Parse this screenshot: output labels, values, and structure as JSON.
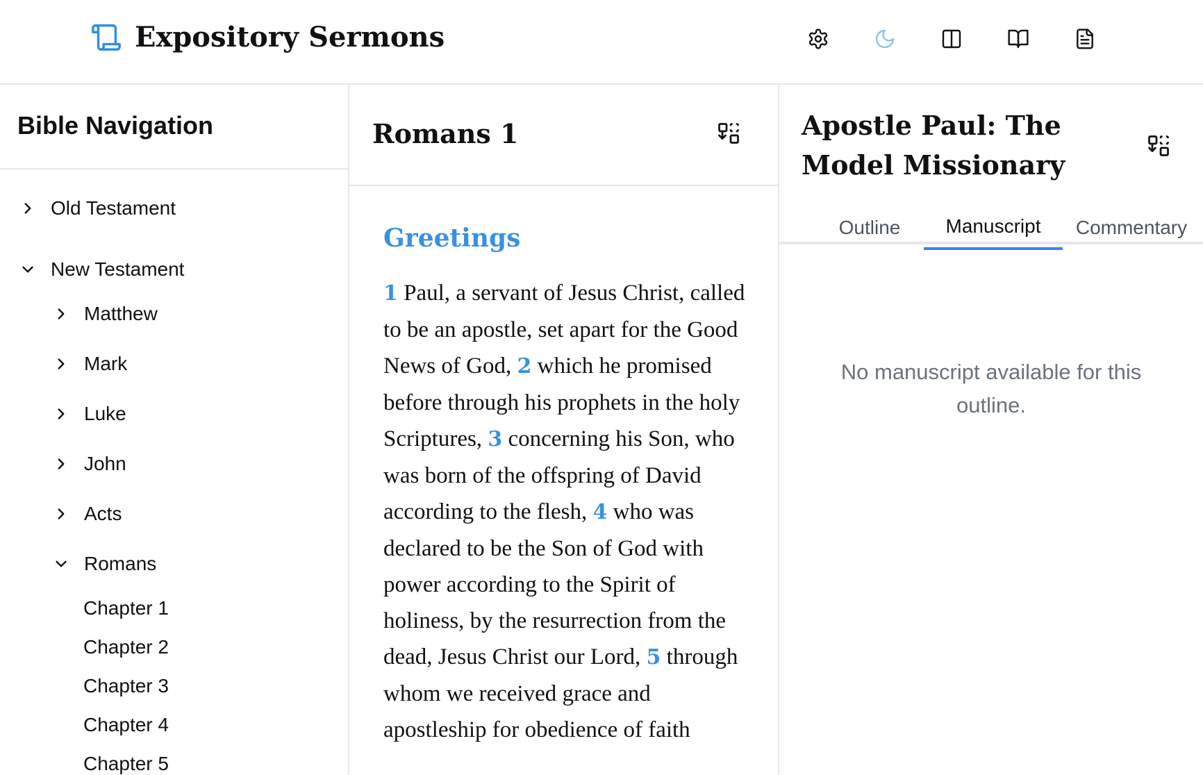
{
  "header": {
    "title": "Expository Sermons",
    "logo_icon": "scroll-icon",
    "accent": "#3b91e0",
    "toolbar": [
      {
        "name": "settings-button",
        "icon": "gear-icon"
      },
      {
        "name": "dark-mode-button",
        "icon": "moon-icon"
      },
      {
        "name": "split-view-button",
        "icon": "columns-icon"
      },
      {
        "name": "bible-button",
        "icon": "book-open-icon"
      },
      {
        "name": "notes-button",
        "icon": "document-icon"
      }
    ]
  },
  "nav": {
    "title": "Bible Navigation",
    "old_testament": "Old Testament",
    "new_testament": "New Testament",
    "books": [
      "Matthew",
      "Mark",
      "Luke",
      "John",
      "Acts",
      "Romans"
    ],
    "open_book": "Romans",
    "chapters": [
      "Chapter 1",
      "Chapter 2",
      "Chapter 3",
      "Chapter 4",
      "Chapter 5"
    ]
  },
  "bible": {
    "title": "Romans 1",
    "section_heading": "Greetings",
    "verses": [
      {
        "num": "1",
        "text": "Paul, a servant of Jesus Christ, called to be an apostle, set apart for the Good News of God,"
      },
      {
        "num": "2",
        "text": "which he promised before through his prophets in the holy Scriptures,"
      },
      {
        "num": "3",
        "text": "concerning his Son, who was born of the offspring of David according to the flesh,"
      },
      {
        "num": "4",
        "text": "who was declared to be the Son of God with power according to the Spirit of holiness, by the resurrection from the dead, Jesus Christ our Lord,"
      },
      {
        "num": "5",
        "text": "through whom we received grace and apostleship for obedience of faith"
      }
    ]
  },
  "sermon": {
    "title": "Apostle Paul: The Model Missionary",
    "tabs": [
      "Outline",
      "Manuscript",
      "Commentary"
    ],
    "active_tab": "Manuscript",
    "empty_message": "No manuscript available for this outline."
  }
}
